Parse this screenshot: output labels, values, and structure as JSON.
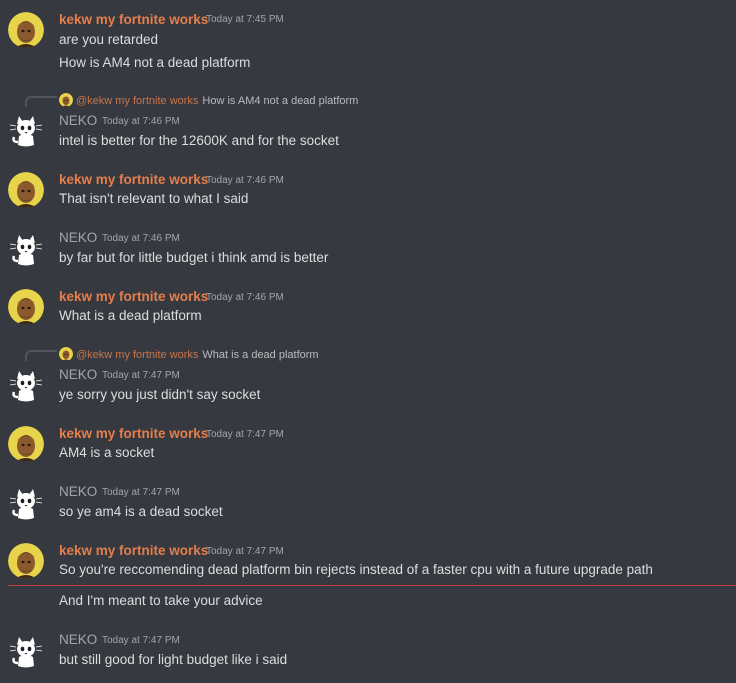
{
  "users": {
    "kekw": {
      "name": "kekw my fortnite works",
      "color": "#e67e4a"
    },
    "neko": {
      "name": "NEKO",
      "color": "#a3a6aa"
    }
  },
  "colors": {
    "background": "#36393f",
    "message_text": "#dcddde",
    "timestamp": "#a3a6aa",
    "reply_name": "#c9744a",
    "divider": "#ed4245"
  },
  "messages": [
    {
      "author": "kekw my fortnite works",
      "timestamp": "Today at 7:45 PM",
      "lines": [
        "are you retarded",
        "How is AM4 not a dead platform"
      ]
    },
    {
      "reply_to": {
        "author": "@kekw my fortnite works",
        "text": "How is AM4 not a dead platform"
      },
      "author": "NEKO",
      "timestamp": "Today at 7:46 PM",
      "lines": [
        "intel is better for the 12600K and for the socket"
      ]
    },
    {
      "author": "kekw my fortnite works",
      "timestamp": "Today at 7:46 PM",
      "lines": [
        "That isn't relevant to what I said"
      ]
    },
    {
      "author": "NEKO",
      "timestamp": "Today at 7:46 PM",
      "lines": [
        "by far but for little budget i think amd is better"
      ]
    },
    {
      "author": "kekw my fortnite works",
      "timestamp": "Today at 7:46 PM",
      "lines": [
        "What is a dead platform"
      ]
    },
    {
      "reply_to": {
        "author": "@kekw my fortnite works",
        "text": "What is a dead platform"
      },
      "author": "NEKO",
      "timestamp": "Today at 7:47 PM",
      "lines": [
        "ye sorry you just didn't say socket"
      ]
    },
    {
      "author": "kekw my fortnite works",
      "timestamp": "Today at 7:47 PM",
      "lines": [
        "AM4 is a socket"
      ]
    },
    {
      "author": "NEKO",
      "timestamp": "Today at 7:47 PM",
      "lines": [
        "so ye am4 is a dead socket"
      ]
    },
    {
      "author": "kekw my fortnite works",
      "timestamp": "Today at 7:47 PM",
      "lines": [
        "So you're reccomending dead platform bin rejects instead of a faster cpu with a future upgrade path",
        "And I'm meant to take your advice"
      ]
    },
    {
      "author": "NEKO",
      "timestamp": "Today at 7:47 PM",
      "lines": [
        "but still good for light budget like i said"
      ]
    }
  ]
}
